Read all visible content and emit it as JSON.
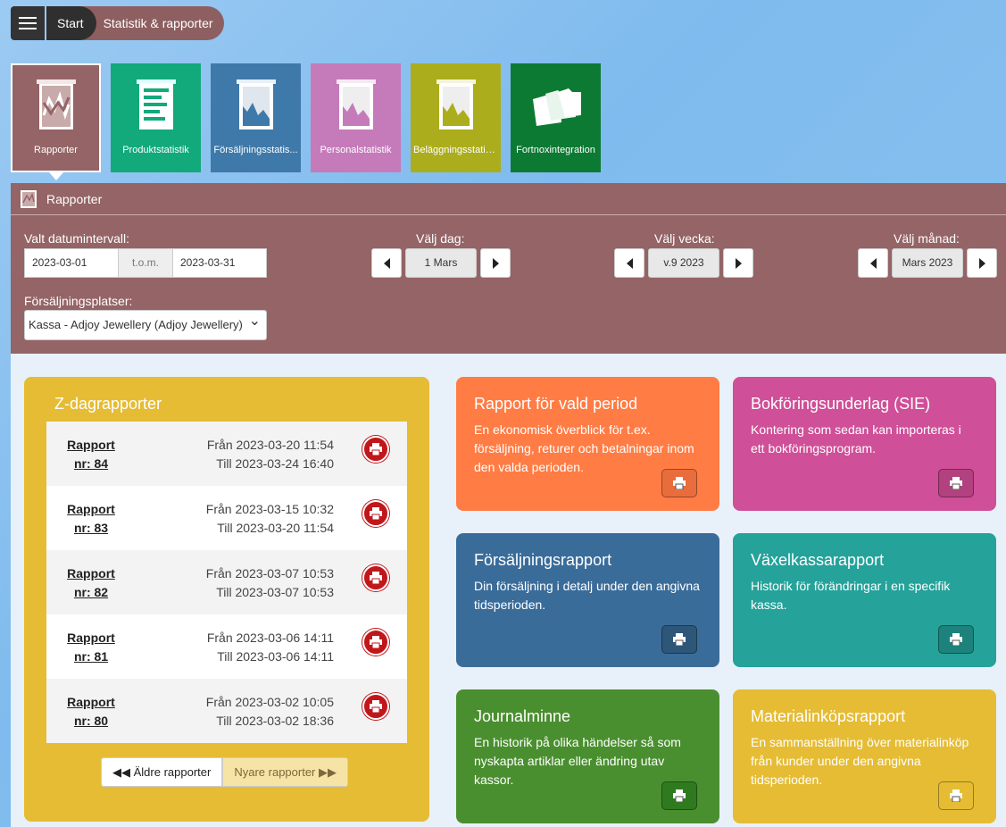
{
  "breadcrumb": {
    "start": "Start",
    "current": "Statistik & rapporter"
  },
  "tiles": [
    {
      "label": "Rapporter",
      "color": "#946466",
      "icon": "line-chart-icon"
    },
    {
      "label": "Produktstatistik",
      "color": "#12a97b",
      "icon": "document-list-icon"
    },
    {
      "label": "Försäljningsstatis...",
      "color": "#3f79a9",
      "icon": "area-chart-icon"
    },
    {
      "label": "Personalstatistik",
      "color": "#c57bba",
      "icon": "area-chart-icon"
    },
    {
      "label": "Beläggningsstatis...",
      "color": "#abad1d",
      "icon": "area-chart-icon"
    },
    {
      "label": "Fortnoxintegration",
      "color": "#0d7a33",
      "icon": "folders-icon"
    }
  ],
  "panel": {
    "title": "Rapporter",
    "date_range_label": "Valt datumintervall:",
    "date_from": "2023-03-01",
    "date_sep": "t.o.m.",
    "date_to": "2023-03-31",
    "day_label": "Välj dag:",
    "day_value": "1 Mars",
    "week_label": "Välj vecka:",
    "week_value": "v.9 2023",
    "month_label": "Välj månad:",
    "month_value": "Mars 2023",
    "location_label": "Försäljningsplatser:",
    "location_value": "Kassa - Adjoy Jewellery (Adjoy Jewellery)"
  },
  "z_reports": {
    "title": "Z-dagrapporter",
    "rows": [
      {
        "line1": "Rapport",
        "line2": "nr: 84",
        "from": "Från 2023-03-20 11:54",
        "to": "Till 2023-03-24 16:40"
      },
      {
        "line1": "Rapport",
        "line2": "nr: 83",
        "from": "Från 2023-03-15 10:32",
        "to": "Till 2023-03-20 11:54"
      },
      {
        "line1": "Rapport",
        "line2": "nr: 82",
        "from": "Från 2023-03-07 10:53",
        "to": "Till 2023-03-07 10:53"
      },
      {
        "line1": "Rapport",
        "line2": "nr: 81",
        "from": "Från 2023-03-06 14:11",
        "to": "Till 2023-03-06 14:11"
      },
      {
        "line1": "Rapport",
        "line2": "nr: 80",
        "from": "Från 2023-03-02 10:05",
        "to": "Till 2023-03-02 18:36"
      }
    ],
    "older": "Äldre rapporter",
    "newer": "Nyare rapporter"
  },
  "cards": [
    {
      "title": "Rapport för vald period",
      "text": "En ekonomisk överblick för t.ex. försäljning, returer och betalningar inom den valda perioden.",
      "color": "#ff7c44",
      "btn": "#e96d3c"
    },
    {
      "title": "Bokföringsunderlag (SIE)",
      "text": "Kontering som sedan kan importeras i ett bokföringsprogram.",
      "color": "#cf4f98",
      "btn": "#b2417f"
    },
    {
      "title": "Försäljningsrapport",
      "text": "Din försäljning i detalj under den angivna tidsperioden.",
      "color": "#3a6c9a",
      "btn": "#2d5679"
    },
    {
      "title": "Växelkassarapport",
      "text": "Historik för förändringar i en specifik kassa.",
      "color": "#25a29a",
      "btn": "#1d827b"
    },
    {
      "title": "Journalminne",
      "text": "En historik på olika händelser så som nyskapta artiklar eller ändring utav kassor.",
      "color": "#4a8f2f",
      "btn": "#2f7a1f"
    },
    {
      "title": "Materialinköpsrapport",
      "text": "En sammanställning över materialinköp från kunder under den angivna tidsperioden.",
      "color": "#e5bc34",
      "btn": "#e5bc34"
    }
  ]
}
